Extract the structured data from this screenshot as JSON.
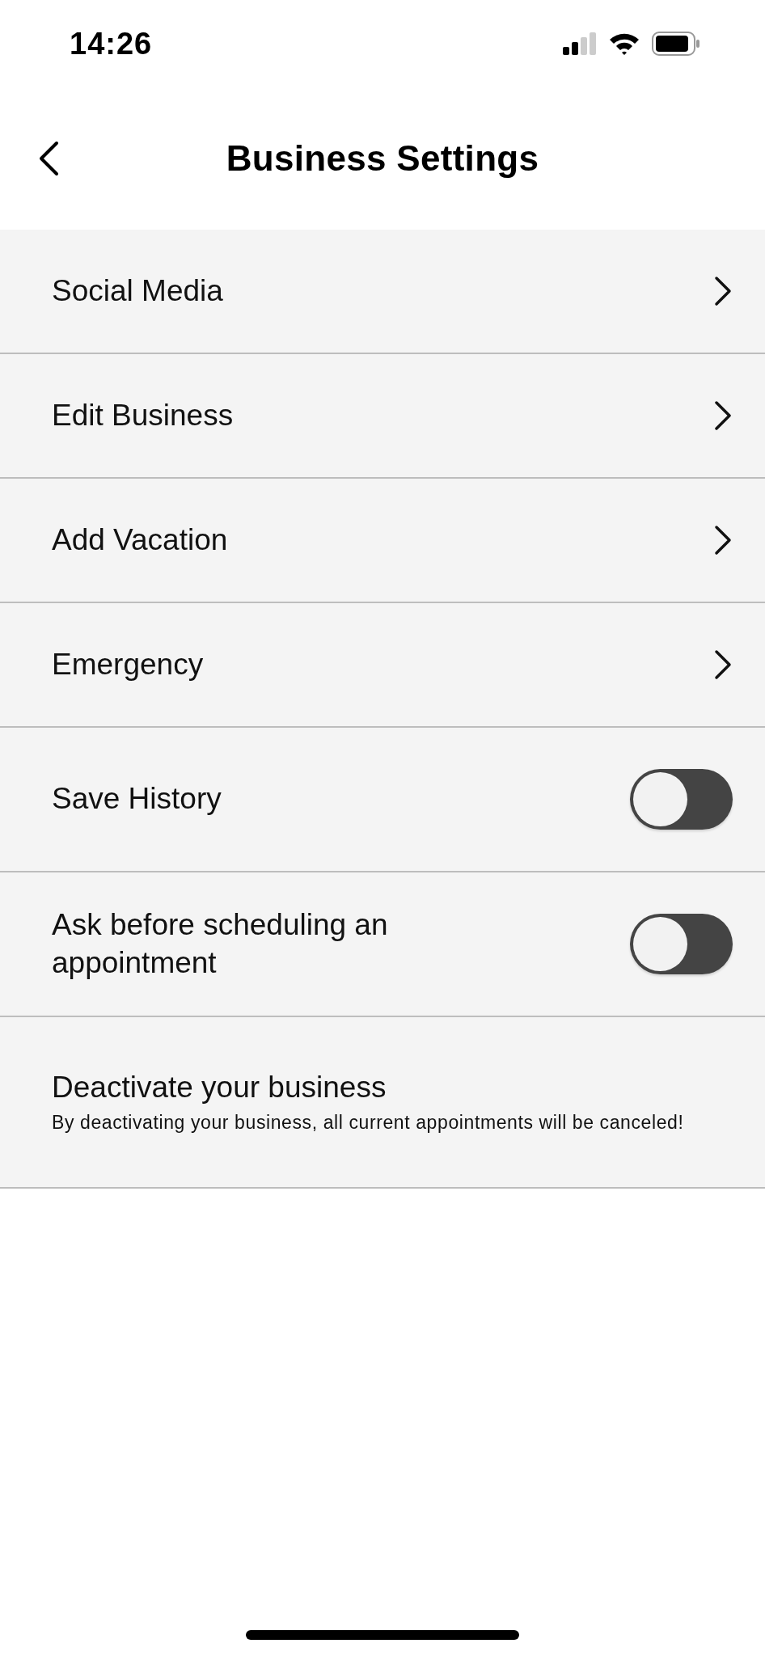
{
  "status_bar": {
    "time": "14:26"
  },
  "header": {
    "title": "Business Settings"
  },
  "settings": [
    {
      "kind": "link",
      "label": "Social Media"
    },
    {
      "kind": "link",
      "label": "Edit Business"
    },
    {
      "kind": "link",
      "label": "Add Vacation"
    },
    {
      "kind": "link",
      "label": "Emergency"
    },
    {
      "kind": "toggle",
      "label": "Save History",
      "on": false
    },
    {
      "kind": "toggle",
      "label": "Ask before scheduling an appointment",
      "on": false
    },
    {
      "kind": "info",
      "label": "Deactivate your business",
      "description": "By deactivating your business, all current appointments will be canceled!"
    }
  ]
}
